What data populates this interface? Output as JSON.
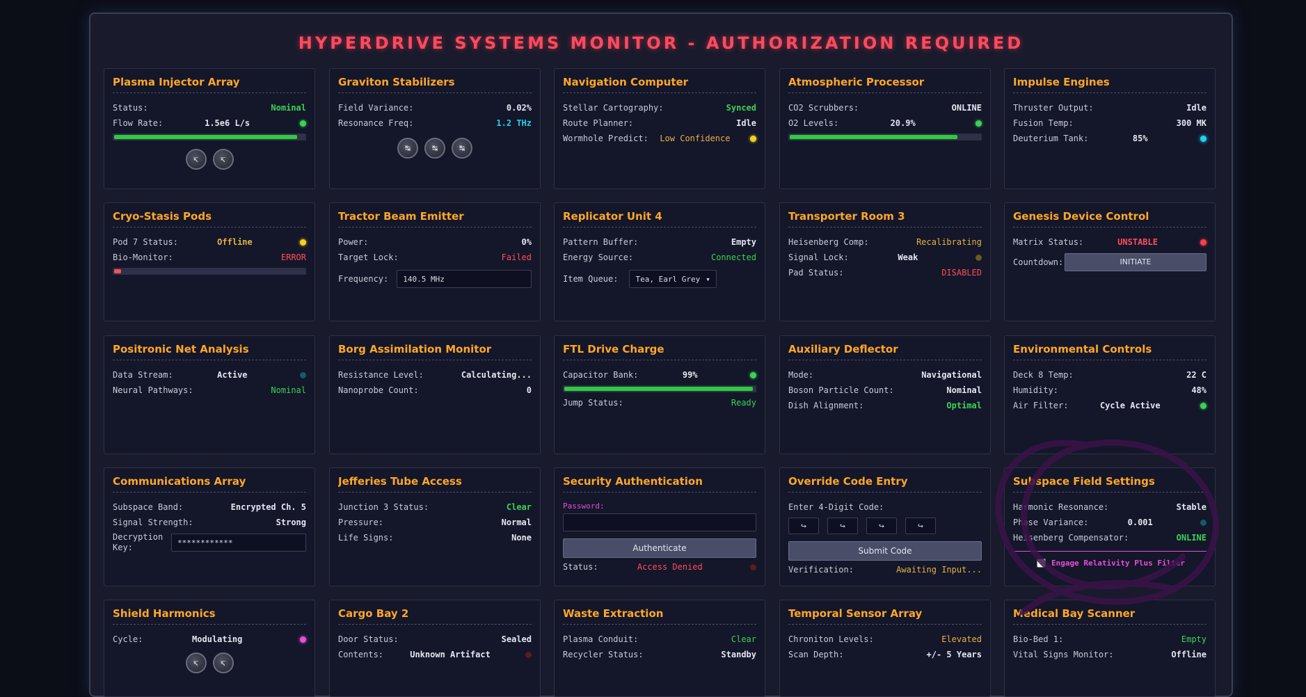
{
  "page_title": "HYPERDRIVE SYSTEMS MONITOR - AUTHORIZATION REQUIRED",
  "colors": {
    "accent": "#ffa726",
    "title": "#ff4a5e",
    "ok": "#39d353",
    "warn": "#e3b341",
    "error": "#ff4d5a",
    "info": "#22d3ee"
  },
  "plasma": {
    "title": "Plasma Injector Array",
    "status_label": "Status:",
    "status_value": "Nominal",
    "flow_label": "Flow Rate:",
    "flow_value": "1.5e6 L/s",
    "flow_fill": 0.96,
    "knob_icons": [
      "knob-icon",
      "knob-icon"
    ]
  },
  "graviton": {
    "title": "Graviton Stabilizers",
    "variance_label": "Field Variance:",
    "variance_value": "0.02%",
    "freq_label": "Resonance Freq:",
    "freq_value": "1.2 THz"
  },
  "nav": {
    "title": "Navigation Computer",
    "stellar_label": "Stellar Cartography:",
    "stellar_value": "Synced",
    "route_label": "Route Planner:",
    "route_value": "Idle",
    "wormhole_label": "Wormhole Predict:",
    "wormhole_value": "Low Confidence"
  },
  "atmo": {
    "title": "Atmospheric Processor",
    "co2_label": "CO2 Scrubbers:",
    "co2_value": "ONLINE",
    "o2_label": "O2 Levels:",
    "o2_value": "20.9%",
    "o2_fill": 0.88
  },
  "impulse": {
    "title": "Impulse Engines",
    "thruster_label": "Thruster Output:",
    "thruster_value": "Idle",
    "fusion_label": "Fusion Temp:",
    "fusion_value": "300 MK",
    "deut_label": "Deuterium Tank:",
    "deut_value": "85%"
  },
  "cryo": {
    "title": "Cryo-Stasis Pods",
    "pod_label": "Pod 7 Status:",
    "pod_value": "Offline",
    "bio_label": "Bio-Monitor:",
    "bio_value": "ERROR",
    "bio_fill": 0.05
  },
  "tractor": {
    "title": "Tractor Beam Emitter",
    "power_label": "Power:",
    "power_value": "0%",
    "lock_label": "Target Lock:",
    "lock_value": "Failed",
    "freq_label": "Frequency:",
    "freq_value": "140.5 MHz"
  },
  "replicator": {
    "title": "Replicator Unit 4",
    "buffer_label": "Pattern Buffer:",
    "buffer_value": "Empty",
    "energy_label": "Energy Source:",
    "energy_value": "Connected",
    "queue_label": "Item Queue:",
    "queue_value": "Tea, Earl Grey"
  },
  "transporter": {
    "title": "Transporter Room 3",
    "heis_label": "Heisenberg Comp:",
    "heis_value": "Recalibrating",
    "signal_label": "Signal Lock:",
    "signal_value": "Weak",
    "pad_label": "Pad Status:",
    "pad_value": "DISABLED"
  },
  "genesis": {
    "title": "Genesis Device Control",
    "matrix_label": "Matrix Status:",
    "matrix_value": "UNSTABLE",
    "countdown_label": "Countdown:",
    "initiate_label": "INITIATE"
  },
  "positronic": {
    "title": "Positronic Net Analysis",
    "stream_label": "Data Stream:",
    "stream_value": "Active",
    "neural_label": "Neural Pathways:",
    "neural_value": "Nominal"
  },
  "borg": {
    "title": "Borg Assimilation Monitor",
    "resist_label": "Resistance Level:",
    "resist_value": "Calculating...",
    "nano_label": "Nanoprobe Count:",
    "nano_value": "0"
  },
  "ftl": {
    "title": "FTL Drive Charge",
    "cap_label": "Capacitor Bank:",
    "cap_value": "99%",
    "cap_fill": 0.99,
    "jump_label": "Jump Status:",
    "jump_value": "Ready"
  },
  "deflector": {
    "title": "Auxiliary Deflector",
    "mode_label": "Mode:",
    "mode_value": "Navigational",
    "boson_label": "Boson Particle Count:",
    "boson_value": "Nominal",
    "dish_label": "Dish Alignment:",
    "dish_value": "Optimal"
  },
  "env": {
    "title": "Environmental Controls",
    "deck_label": "Deck 8 Temp:",
    "deck_value": "22 C",
    "hum_label": "Humidity:",
    "hum_value": "48%",
    "air_label": "Air Filter:",
    "air_value": "Cycle Active"
  },
  "comms": {
    "title": "Communications Array",
    "band_label": "Subspace Band:",
    "band_value": "Encrypted Ch. 5",
    "signal_label": "Signal Strength:",
    "signal_value": "Strong",
    "key_label": "Decryption Key:",
    "key_value": "************"
  },
  "jefferies": {
    "title": "Jefferies Tube Access",
    "junction_label": "Junction 3 Status:",
    "junction_value": "Clear",
    "pressure_label": "Pressure:",
    "pressure_value": "Normal",
    "life_label": "Life Signs:",
    "life_value": "None"
  },
  "security": {
    "title": "Security Authentication",
    "password_label": "Password:",
    "password_value": "",
    "auth_button": "Authenticate",
    "status_label": "Status:",
    "status_value": "Access Denied"
  },
  "override": {
    "title": "Override Code Entry",
    "enter_label": "Enter 4-Digit Code:",
    "submit_button": "Submit Code",
    "verify_label": "Verification:",
    "verify_value": "Awaiting Input..."
  },
  "subspace": {
    "title": "Subspace Field Settings",
    "harm_label": "Harmonic Resonance:",
    "harm_value": "Stable",
    "phase_label": "Phase Variance:",
    "phase_value": "0.001",
    "heis_label": "Heisenberg Compensator:",
    "heis_value": "ONLINE",
    "filter_label": "Engage Relativity Plus Filter"
  },
  "shield": {
    "title": "Shield Harmonics",
    "cycle_label": "Cycle:",
    "cycle_value": "Modulating"
  },
  "cargo": {
    "title": "Cargo Bay 2",
    "door_label": "Door Status:",
    "door_value": "Sealed",
    "contents_label": "Contents:",
    "contents_value": "Unknown Artifact"
  },
  "waste": {
    "title": "Waste Extraction",
    "conduit_label": "Plasma Conduit:",
    "conduit_value": "Clear",
    "recycler_label": "Recycler Status:",
    "recycler_value": "Standby"
  },
  "temporal": {
    "title": "Temporal Sensor Array",
    "chron_label": "Chroniton Levels:",
    "chron_value": "Elevated",
    "depth_label": "Scan Depth:",
    "depth_value": "+/- 5 Years"
  },
  "medical": {
    "title": "Medical Bay Scanner",
    "bed_label": "Bio-Bed 1:",
    "bed_value": "Empty",
    "vital_label": "Vital Signs Monitor:",
    "vital_value": "Offline"
  }
}
